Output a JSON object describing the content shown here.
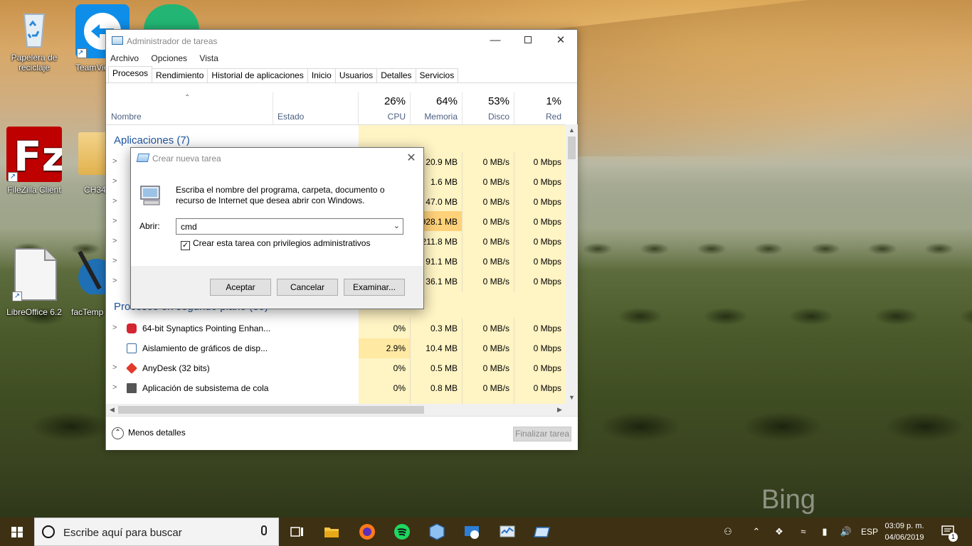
{
  "desktop": {
    "icons": [
      {
        "label": "Papelera de reciclaje"
      },
      {
        "label": "TeamVie"
      },
      {
        "label": "FileZilla Client"
      },
      {
        "label": "CH34"
      },
      {
        "label": "LibreOffice 6.2"
      },
      {
        "label": "facTemp"
      }
    ],
    "watermark": "Bing"
  },
  "task_manager": {
    "title": "Administrador de tareas",
    "menu": [
      "Archivo",
      "Opciones",
      "Vista"
    ],
    "tabs": [
      "Procesos",
      "Rendimiento",
      "Historial de aplicaciones",
      "Inicio",
      "Usuarios",
      "Detalles",
      "Servicios"
    ],
    "active_tab": "Procesos",
    "columns": {
      "name": "Nombre",
      "status": "Estado",
      "cpu": {
        "pct": "26%",
        "label": "CPU"
      },
      "memory": {
        "pct": "64%",
        "label": "Memoria"
      },
      "disk": {
        "pct": "53%",
        "label": "Disco"
      },
      "network": {
        "pct": "1%",
        "label": "Red"
      }
    },
    "groups": {
      "apps": "Aplicaciones (7)",
      "background": "Procesos en segundo plano (30)"
    },
    "app_rows": [
      {
        "mem": "20.9 MB",
        "disk": "0 MB/s",
        "net": "0 Mbps"
      },
      {
        "mem": "1.6 MB",
        "disk": "0 MB/s",
        "net": "0 Mbps"
      },
      {
        "mem": "47.0 MB",
        "disk": "0 MB/s",
        "net": "0 Mbps"
      },
      {
        "mem": "928.1 MB",
        "disk": "0 MB/s",
        "net": "0 Mbps"
      },
      {
        "mem": "211.8 MB",
        "disk": "0 MB/s",
        "net": "0 Mbps"
      },
      {
        "mem": "91.1 MB",
        "disk": "0 MB/s",
        "net": "0 Mbps"
      },
      {
        "mem": "36.1 MB",
        "disk": "0 MB/s",
        "net": "0 Mbps"
      }
    ],
    "bg_rows": [
      {
        "name": "64-bit Synaptics Pointing Enhan...",
        "cpu": "0%",
        "mem": "0.3 MB",
        "disk": "0 MB/s",
        "net": "0 Mbps"
      },
      {
        "name": "Aislamiento de gráficos de disp...",
        "cpu": "2.9%",
        "mem": "10.4 MB",
        "disk": "0 MB/s",
        "net": "0 Mbps"
      },
      {
        "name": "AnyDesk (32 bits)",
        "cpu": "0%",
        "mem": "0.5 MB",
        "disk": "0 MB/s",
        "net": "0 Mbps"
      },
      {
        "name": "Aplicación de subsistema de cola",
        "cpu": "0%",
        "mem": "0.8 MB",
        "disk": "0 MB/s",
        "net": "0 Mbps"
      }
    ],
    "footer": {
      "less_details": "Menos detalles",
      "end_task": "Finalizar tarea"
    }
  },
  "dialog": {
    "title": "Crear nueva tarea",
    "description": "Escriba el nombre del programa, carpeta, documento o recurso de Internet que desea abrir con Windows.",
    "open_label": "Abrir:",
    "open_value": "cmd",
    "admin_checkbox": "Crear esta tarea con privilegios administrativos",
    "admin_checked": true,
    "buttons": {
      "ok": "Aceptar",
      "cancel": "Cancelar",
      "browse": "Examinar..."
    }
  },
  "taskbar": {
    "search_placeholder": "Escribe aquí para buscar",
    "language": "ESP",
    "time": "03:09 p. m.",
    "date": "04/06/2019",
    "notifications": "1"
  },
  "colors": {
    "taskbar": "#3e3012",
    "cpu_shade": "#fff4c4",
    "memory_highlight": "#ffd279",
    "group_title": "#1e56a0"
  }
}
